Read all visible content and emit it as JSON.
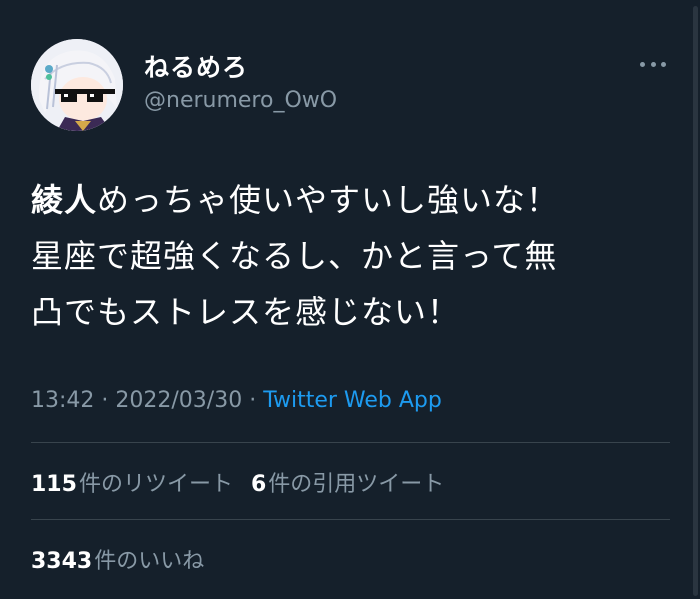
{
  "user": {
    "display_name": "ねるめろ",
    "handle": "@nerumero_OwO",
    "avatar_icon": "avatar-icon"
  },
  "tweet": {
    "text_bold": "綾人",
    "line1_rest": "めっちゃ使いやすいし強いな！",
    "line2": "星座で超強くなるし、かと言って無",
    "line3": "凸でもストレスを感じない！"
  },
  "meta": {
    "time": "13:42",
    "sep1": " · ",
    "date": "2022/03/30",
    "sep2": " · ",
    "source": "Twitter Web App"
  },
  "stats": {
    "retweets_count": "115",
    "retweets_label": "件のリツイート",
    "quotes_count": "6",
    "quotes_label": "件の引用ツイート",
    "likes_count": "3343",
    "likes_label": "件のいいね"
  },
  "colors": {
    "background": "#15202b",
    "link": "#1d9bf0",
    "muted": "#8899a6",
    "divider": "#38444d"
  }
}
